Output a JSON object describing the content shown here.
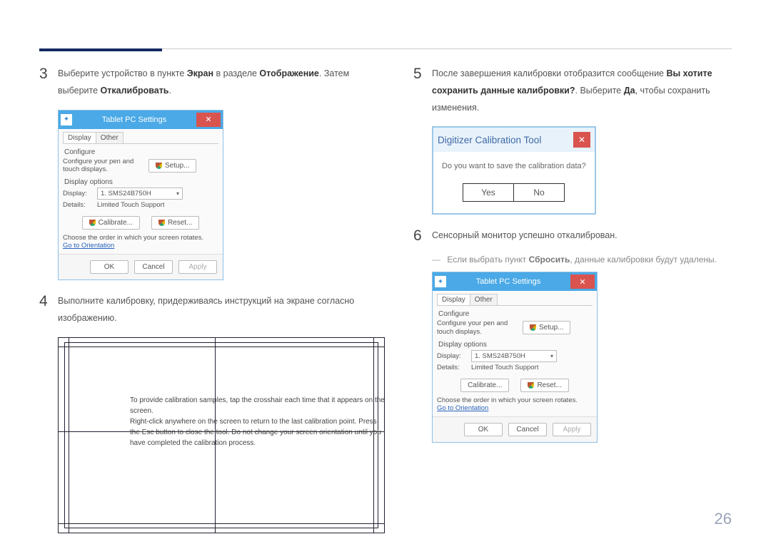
{
  "page_number": "26",
  "steps": {
    "s3": {
      "num": "3",
      "pre": "Выберите устройство в пункте ",
      "b1": "Экран",
      "mid": " в разделе ",
      "b2": "Oтображение",
      "post": ". Затем выберите ",
      "b3": "Oткалибровать",
      "end": "."
    },
    "s4": {
      "num": "4",
      "text": "Выполните калибровку, придерживаясь инструкций на экране согласно изображению."
    },
    "s5": {
      "num": "5",
      "pre": "После завершения калибровки отобразится сообщение ",
      "b1": "Вы хотите сохранить данные калибровки?",
      "mid": ". Выберите ",
      "b2": "Да",
      "post": ", чтобы сохранить изменения."
    },
    "s6": {
      "num": "6",
      "text": "Сенсорный монитор успешно откалиброван."
    }
  },
  "note": {
    "pre": "Если выбрать пункт ",
    "b": "Сбросить",
    "post": ", данные калибровки будут удалены."
  },
  "win": {
    "title": "Tablet PC Settings",
    "tab_display": "Display",
    "tab_other": "Other",
    "configure": "Configure",
    "configure_desc": "Configure your pen and touch displays.",
    "setup": "Setup...",
    "display_options": "Display options",
    "display_label": "Display:",
    "display_value": "1. SMS24B750H",
    "details_label": "Details:",
    "details_value": "Limited Touch Support",
    "calibrate": "Calibrate...",
    "reset": "Reset...",
    "rotate_note": "Choose the order in which your screen rotates.",
    "go_link": "Go to Orientation",
    "ok": "OK",
    "cancel": "Cancel",
    "apply": "Apply"
  },
  "calib_text": "To provide calibration samples, tap the crosshair each time that it appears on the screen.\nRight-click anywhere on the screen to return to the last calibration point. Press the Esc button to close the tool. Do not change your screen orientation until you have completed the calibration process.",
  "dlg": {
    "title": "Digitizer Calibration Tool",
    "body": "Do you want to save the calibration data?",
    "yes": "Yes",
    "no": "No"
  }
}
